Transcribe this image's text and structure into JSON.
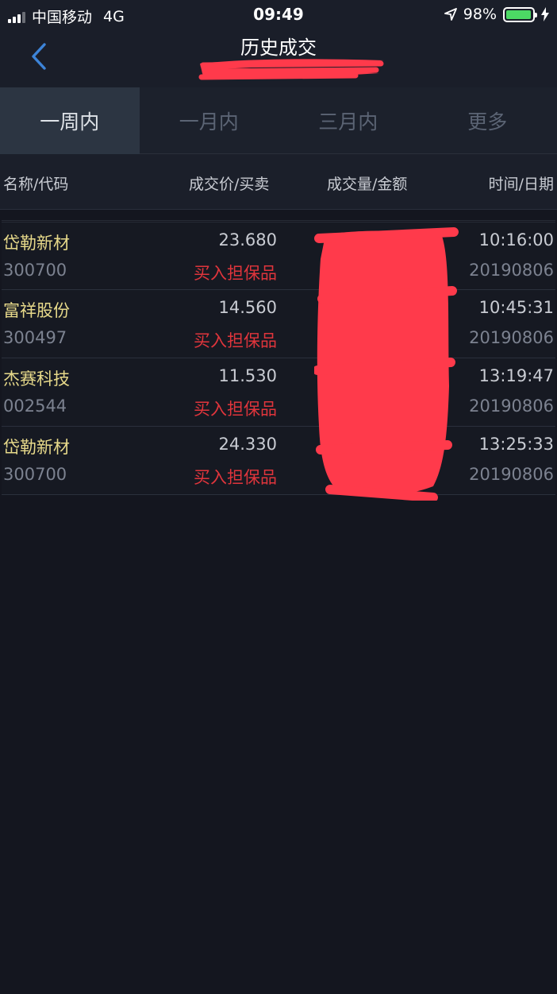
{
  "status_bar": {
    "carrier": "中国移动",
    "network": "4G",
    "time": "09:49",
    "battery": "98%",
    "battery_level": 0.98
  },
  "nav": {
    "title": "历史成交"
  },
  "tabs": [
    {
      "label": "一周内",
      "active": true
    },
    {
      "label": "一月内",
      "active": false
    },
    {
      "label": "三月内",
      "active": false
    },
    {
      "label": "更多",
      "active": false
    }
  ],
  "table": {
    "headers": {
      "name_code": "名称/代码",
      "price_side": "成交价/买卖",
      "volume_amount": "成交量/金额",
      "time_date": "时间/日期"
    },
    "rows": [
      {
        "name": "岱勒新材",
        "code": "300700",
        "price": "23.680",
        "action": "买入担保品",
        "time": "10:16:00",
        "date": "20190806"
      },
      {
        "name": "富祥股份",
        "code": "300497",
        "price": "14.560",
        "action": "买入担保品",
        "time": "10:45:31",
        "date": "20190806"
      },
      {
        "name": "杰赛科技",
        "code": "002544",
        "price": "11.530",
        "action": "买入担保品",
        "time": "13:19:47",
        "date": "20190806"
      },
      {
        "name": "岱勒新材",
        "code": "300700",
        "price": "24.330",
        "action": "买入担保品",
        "time": "13:25:33",
        "date": "20190806"
      }
    ]
  },
  "colors": {
    "background": "#14161f",
    "stock_name": "#e7d98a",
    "buy_action": "#e0353c",
    "redaction": "#ff3a4b",
    "active_tab": "#2c3542"
  }
}
